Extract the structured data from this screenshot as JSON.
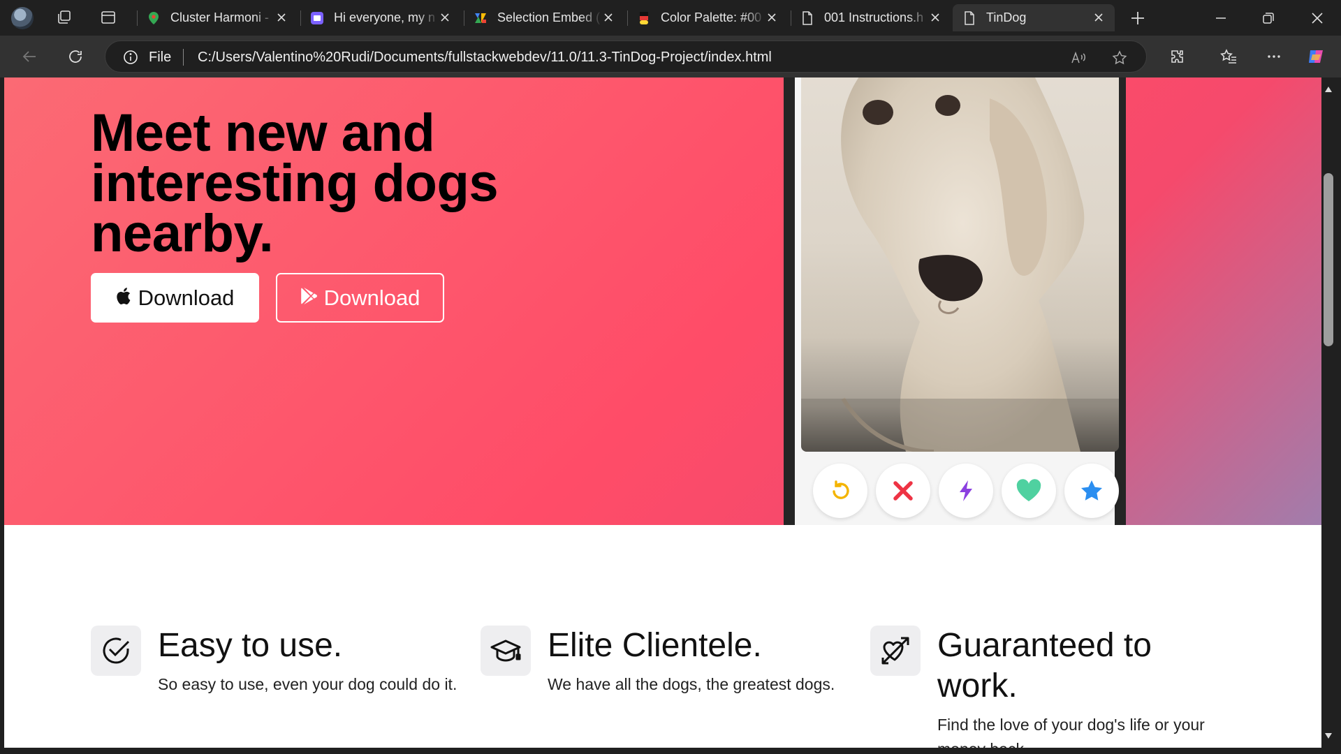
{
  "browser": {
    "tabs": [
      {
        "title": "Cluster Harmoni - ",
        "favicon": "maps-pin-icon"
      },
      {
        "title": "Hi everyone, my n",
        "favicon": "calendar-app-icon"
      },
      {
        "title": "Selection Embed (",
        "favicon": "colorful-logo-icon"
      },
      {
        "title": "Color Palette: #00",
        "favicon": "palette-icon"
      },
      {
        "title": "001 Instructions.h",
        "favicon": "document-icon"
      },
      {
        "title": "TinDog",
        "favicon": "document-icon"
      }
    ],
    "address": {
      "scheme_label": "File",
      "url": "C:/Users/Valentino%20Rudi/Documents/fullstackwebdev/11.0/11.3-TinDog-Project/index.html"
    }
  },
  "hero": {
    "headline": "Meet new and interesting dogs nearby.",
    "buttons": [
      {
        "label": "Download",
        "icon": "apple-icon"
      },
      {
        "label": "Download",
        "icon": "google-play-icon"
      }
    ]
  },
  "features": [
    {
      "icon": "check-circle-icon",
      "title": "Easy to use.",
      "text": "So easy to use, even your dog could do it."
    },
    {
      "icon": "graduation-cap-icon",
      "title": "Elite Clientele.",
      "text": "We have all the dogs, the greatest dogs."
    },
    {
      "icon": "heart-arrow-icon",
      "title": "Guaranteed to work.",
      "text": "Find the love of your dog's life or your money back."
    }
  ],
  "colors": {
    "hero_gradient_start": "#fb6a74",
    "hero_gradient_end": "#a17dac",
    "chrome_dark": "#202020",
    "chrome_toolbar": "#323232"
  }
}
